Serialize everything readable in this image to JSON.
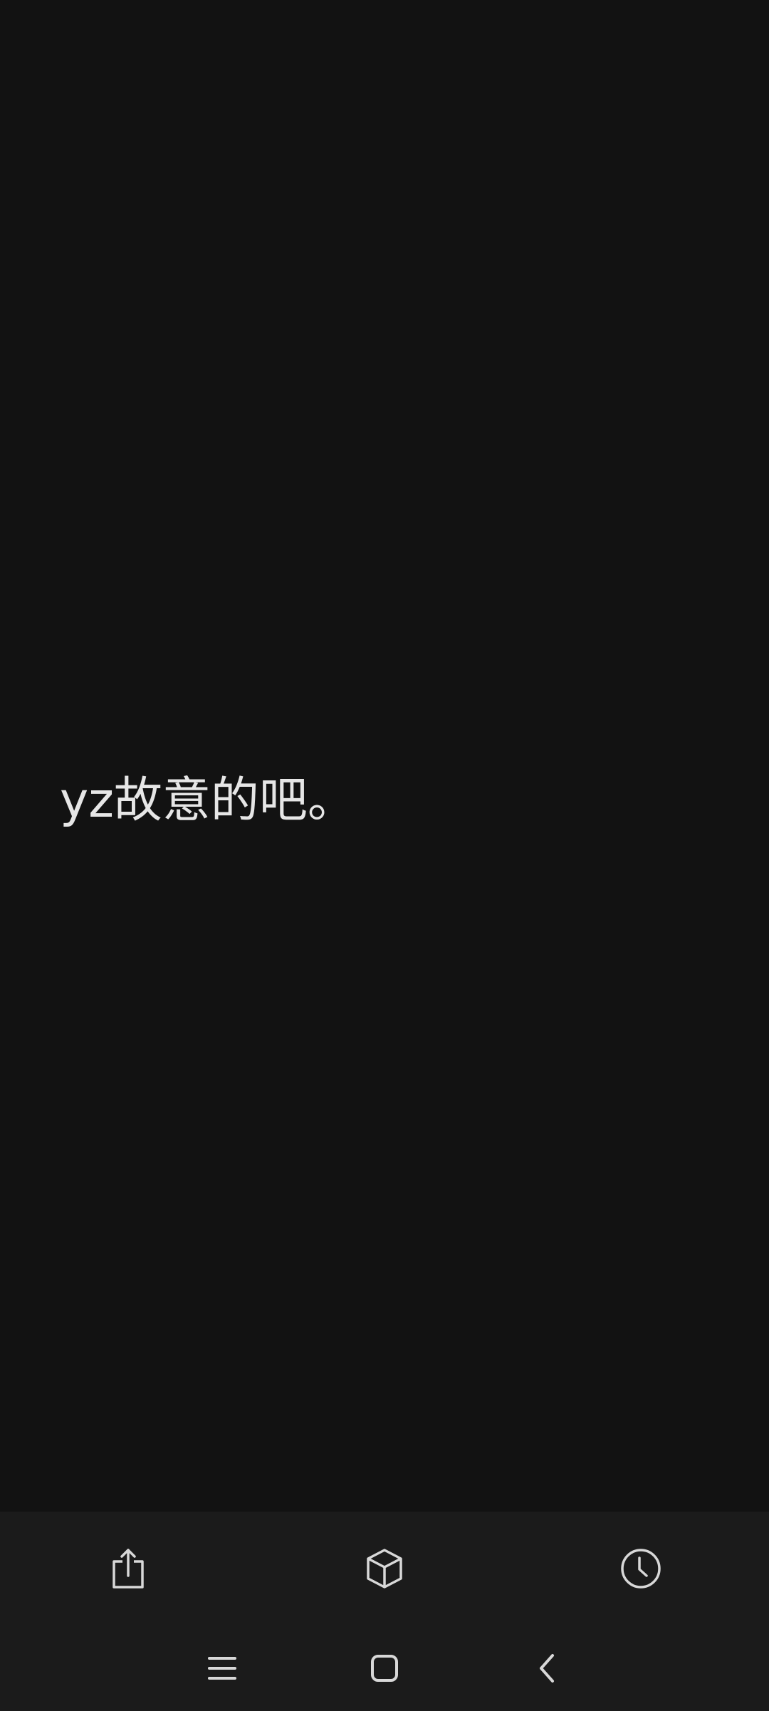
{
  "post": {
    "text": "yz故意的吧。"
  },
  "colors": {
    "background": "#121212",
    "bottom_bar": "#1b1b1b",
    "text": "#e6e6e6",
    "icon": "#d8d8d8"
  },
  "toolbar": {
    "icons": [
      "share-icon",
      "cube-icon",
      "clock-icon"
    ]
  },
  "navigation": {
    "icons": [
      "recent-apps-icon",
      "home-icon",
      "back-icon"
    ]
  }
}
